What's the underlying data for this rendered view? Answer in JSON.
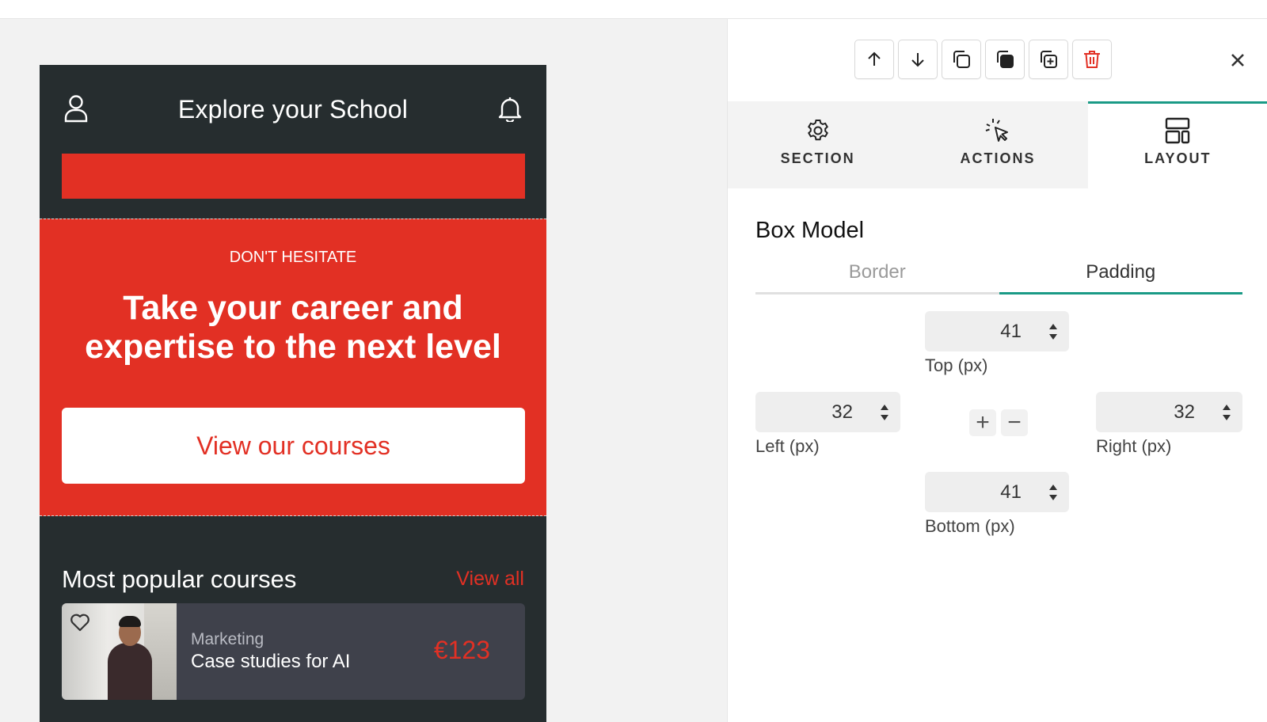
{
  "phone": {
    "app_title": "Explore your School",
    "hero": {
      "eyebrow": "DON'T HESITATE",
      "title": "Take your career and expertise to the next level",
      "cta_label": "View our courses"
    },
    "popular": {
      "title": "Most popular courses",
      "view_all": "View all",
      "course": {
        "category": "Marketing",
        "name": "Case studies for AI",
        "price": "€123"
      }
    },
    "colors": {
      "brand_red": "#e23024",
      "dark_bg": "#262d2f",
      "card_bg": "#3f414b"
    }
  },
  "panel": {
    "toolbar": {
      "icons": [
        "arrow-up-icon",
        "arrow-down-icon",
        "duplicate-icon",
        "copy-style-icon",
        "add-block-icon",
        "trash-icon"
      ]
    },
    "close_icon": "close-icon",
    "tabs": [
      {
        "label": "SECTION",
        "icon": "gear-icon"
      },
      {
        "label": "ACTIONS",
        "icon": "cursor-click-icon"
      },
      {
        "label": "LAYOUT",
        "icon": "layout-icon",
        "active": true
      }
    ],
    "box_model": {
      "heading": "Box Model",
      "subtabs": [
        {
          "label": "Border"
        },
        {
          "label": "Padding",
          "active": true
        }
      ],
      "top": {
        "value": "41",
        "label": "Top (px)"
      },
      "left": {
        "value": "32",
        "label": "Left (px)"
      },
      "right": {
        "value": "32",
        "label": "Right (px)"
      },
      "bottom": {
        "value": "41",
        "label": "Bottom (px)"
      },
      "plus": "+",
      "minus": "−"
    },
    "colors": {
      "accent": "#1a9a86",
      "danger": "#e23024"
    }
  }
}
